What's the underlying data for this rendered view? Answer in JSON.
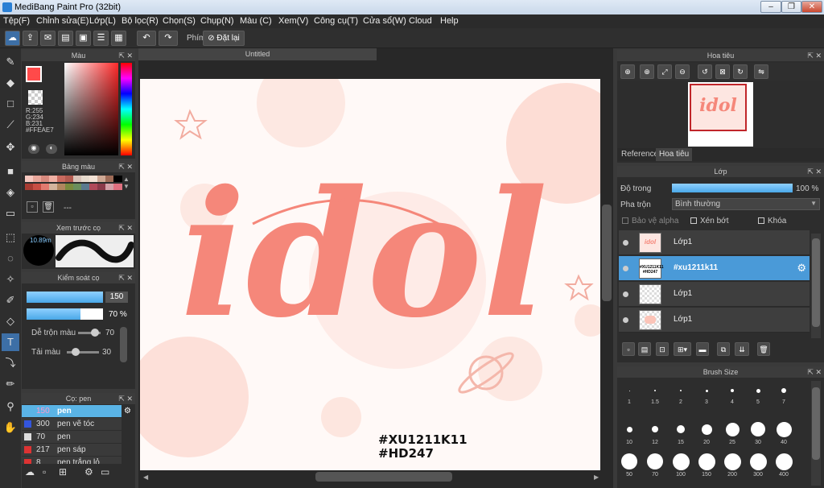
{
  "window": {
    "title": "MediBang Paint Pro (32bit)",
    "min": "–",
    "max": "❐",
    "close": "✕"
  },
  "menu": [
    "Tệp(F)",
    "Chỉnh sửa(E)",
    "Lớp(L)",
    "Bộ lọc(R)",
    "Chọn(S)",
    "Chụp(N)",
    "Màu (C)",
    "Xem(V)",
    "Công cụ(T)",
    "Cửa sổ(W)",
    "Cloud",
    "Help"
  ],
  "toolbar": {
    "shortcut_label": "Phím",
    "reset_label": "Đặt lại"
  },
  "color_panel": {
    "title": "Màu",
    "r": "R:255",
    "g": "G:234",
    "b": "B:231",
    "hex": "#FFEAE7",
    "main_color": "#ff4a4a",
    "sub_color": "#ffeae7"
  },
  "palette_panel": {
    "title": "Bảng màu",
    "more": "---"
  },
  "brush_preview": {
    "title": "Xem trước cọ",
    "size": "10.89m"
  },
  "brush_control": {
    "title": "Kiểm soát cọ",
    "size_value": "150",
    "opacity_value": "70 %",
    "mix_label": "Dễ trộn màu",
    "mix_value": "70",
    "reuse_label": "Tải màu",
    "reuse_value": "30"
  },
  "brush_list": {
    "title": "Cọ: pen",
    "items": [
      {
        "size": "150",
        "name": "pen",
        "color": "#5ab4e6"
      },
      {
        "size": "300",
        "name": "pen vẽ tóc",
        "color": "#3355dd"
      },
      {
        "size": "70",
        "name": "pen",
        "color": "#dddddd"
      },
      {
        "size": "217",
        "name": "pen sáp",
        "color": "#dd3333"
      },
      {
        "size": "8",
        "name": "pen trắng lỏ",
        "color": "#dd3333"
      }
    ]
  },
  "tab": {
    "title": "Untitled"
  },
  "artwork": {
    "word": "idol",
    "tag1": "#XU1211K11",
    "tag2": "#HD247"
  },
  "navigator": {
    "title": "Hoa tiêu",
    "tab_reference": "Reference",
    "tab_navigator": "Hoa tiêu"
  },
  "layer_panel": {
    "title": "Lớp",
    "opacity_label": "Độ trong",
    "opacity_value": "100 %",
    "blend_label": "Pha trộn",
    "blend_value": "Bình thường",
    "protect_alpha": "Bảo vệ alpha",
    "clipping": "Xén bớt",
    "lock": "Khóa",
    "layers": [
      {
        "name": "Lớp1"
      },
      {
        "name": "#xu1211k11"
      },
      {
        "name": "Lớp1"
      },
      {
        "name": "Lớp1"
      }
    ]
  },
  "brush_size": {
    "title": "Brush Size",
    "row1": [
      "1",
      "1.5",
      "2",
      "3",
      "4",
      "5",
      "7"
    ],
    "row2": [
      "10",
      "12",
      "15",
      "20",
      "25",
      "30",
      "40"
    ],
    "row3": [
      "50",
      "70",
      "100",
      "150",
      "200",
      "300",
      "400"
    ]
  }
}
